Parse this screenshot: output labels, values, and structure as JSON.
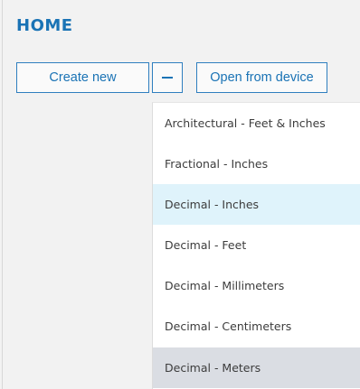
{
  "header": {
    "title": "HOME"
  },
  "toolbar": {
    "create_label": "Create new",
    "toggle_icon": "minus-icon",
    "open_label": "Open from device"
  },
  "dropdown": {
    "items": [
      {
        "label": "Architectural - Feet & Inches",
        "state": "normal"
      },
      {
        "label": "Fractional - Inches",
        "state": "normal"
      },
      {
        "label": "Decimal - Inches",
        "state": "hover"
      },
      {
        "label": "Decimal - Feet",
        "state": "normal"
      },
      {
        "label": "Decimal - Millimeters",
        "state": "normal"
      },
      {
        "label": "Decimal - Centimeters",
        "state": "normal"
      },
      {
        "label": "Decimal - Meters",
        "state": "selected"
      }
    ]
  },
  "colors": {
    "accent": "#1a73b5",
    "background": "#f2f2f2",
    "hover": "#dff3fb",
    "selected": "#dadde3"
  }
}
